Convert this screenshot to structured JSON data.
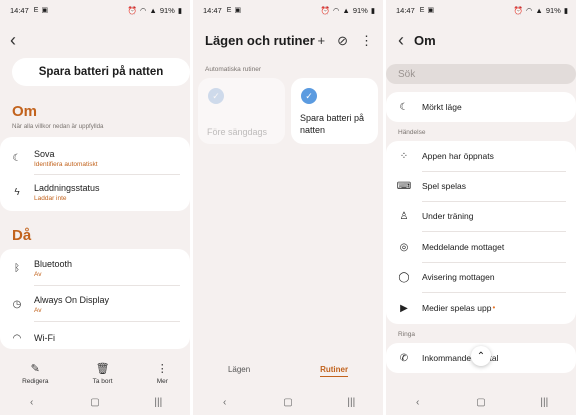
{
  "status_bar": {
    "time": "14:47",
    "letter": "E",
    "battery": "91%"
  },
  "panel1": {
    "title": "Spara batteri på natten",
    "om": {
      "heading": "Om",
      "subtitle": "När alla villkor nedan är uppfyllda",
      "items": [
        {
          "label": "Sova",
          "sub": "Identifiera automatiskt",
          "icon": "moon-icon"
        },
        {
          "label": "Laddningsstatus",
          "sub": "Laddar inte",
          "icon": "bolt-icon"
        }
      ]
    },
    "da": {
      "heading": "Då",
      "items": [
        {
          "label": "Bluetooth",
          "sub": "Av",
          "icon": "bluetooth-icon"
        },
        {
          "label": "Always On Display",
          "sub": "Av",
          "icon": "display-icon"
        },
        {
          "label": "Wi-Fi",
          "sub": "",
          "icon": "wifi-icon"
        }
      ]
    },
    "bottom_actions": [
      {
        "label": "Redigera",
        "icon": "pencil-icon"
      },
      {
        "label": "Ta bort",
        "icon": "trash-icon"
      },
      {
        "label": "Mer",
        "icon": "more-icon"
      }
    ]
  },
  "panel2": {
    "title": "Lägen och rutiner",
    "section_label": "Automatiska rutiner",
    "routines": [
      {
        "label": "Före sängdags",
        "enabled": false
      },
      {
        "label": "Spara batteri på natten",
        "enabled": true
      }
    ],
    "tabs": [
      {
        "label": "Lägen",
        "active": false
      },
      {
        "label": "Rutiner",
        "active": true
      }
    ]
  },
  "panel3": {
    "title": "Om",
    "search_placeholder": "Sök",
    "top_item": {
      "label": "Mörkt läge",
      "icon": "moon-icon"
    },
    "section_handelse": "Händelse",
    "handelse_items": [
      {
        "label": "Appen har öppnats",
        "icon": "apps-grid-icon"
      },
      {
        "label": "Spel spelas",
        "icon": "gamepad-icon"
      },
      {
        "label": "Under träning",
        "icon": "running-icon"
      },
      {
        "label": "Meddelande mottaget",
        "icon": "message-icon"
      },
      {
        "label": "Avisering mottagen",
        "icon": "notification-icon"
      },
      {
        "label": "Medier spelas upp",
        "icon": "play-icon"
      }
    ],
    "section_ringa": "Ringa",
    "ringa_items": [
      {
        "label": "Inkommande samtal",
        "icon": "incoming-call-icon"
      }
    ]
  },
  "colors": {
    "accent": "#c2631d",
    "routine_blue": "#5b9be0",
    "background": "#f5f0ef"
  }
}
